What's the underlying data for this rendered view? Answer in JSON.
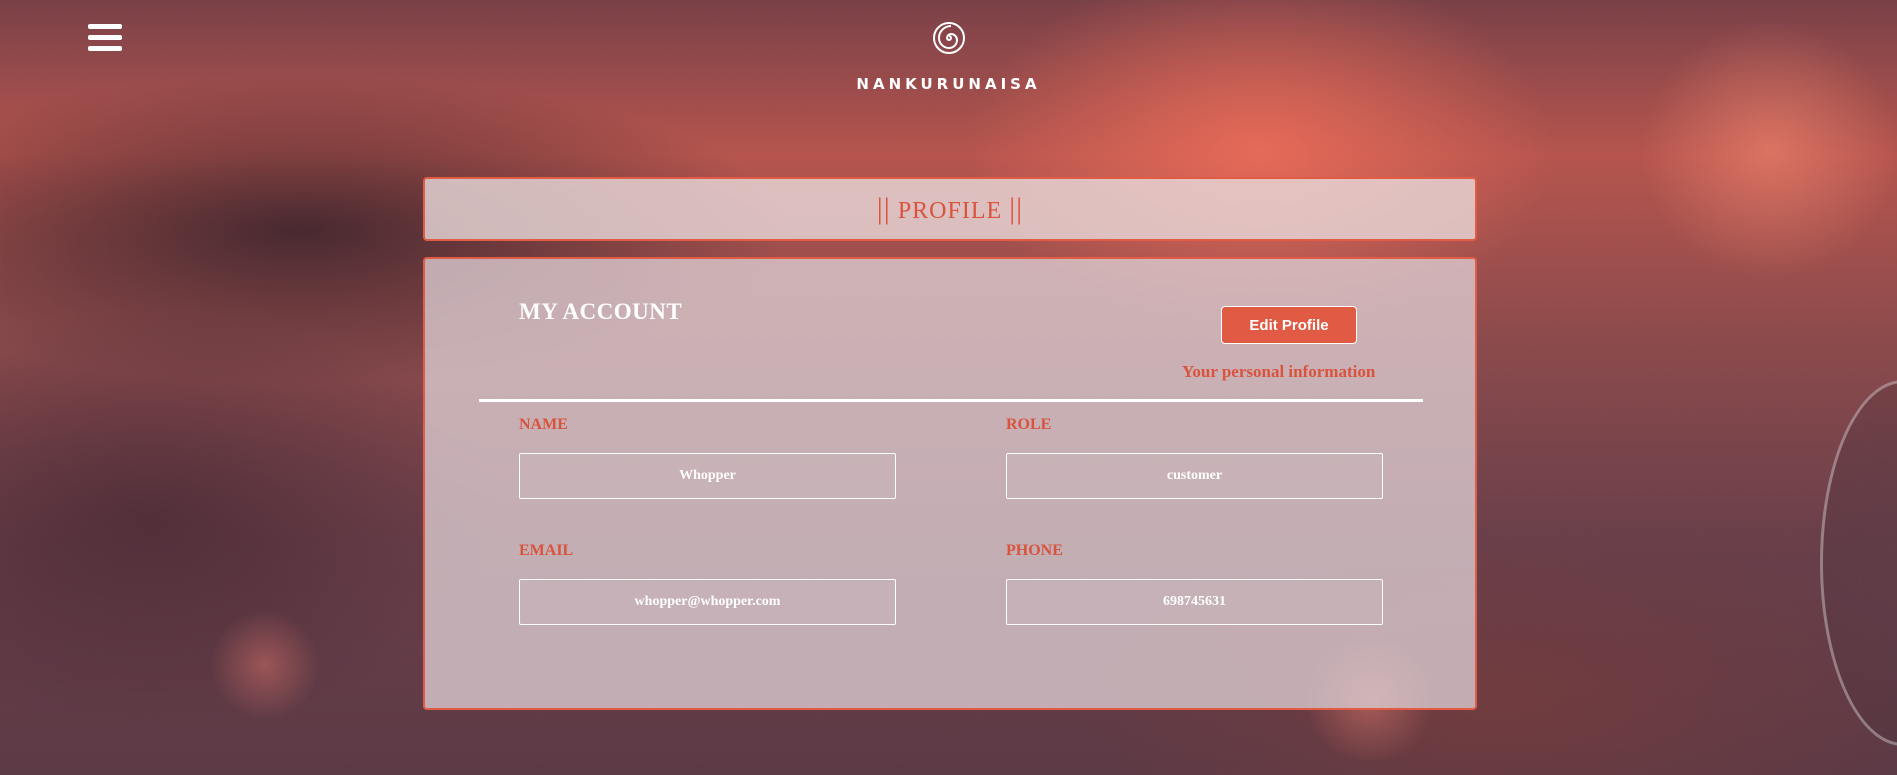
{
  "header": {
    "brand": "NANKURUNAISA",
    "logo_icon": "spiral-icon",
    "menu_icon": "hamburger-icon"
  },
  "title_bar": {
    "left_bars": "||",
    "title": "PROFILE",
    "right_bars": "||"
  },
  "account": {
    "heading": "MY ACCOUNT",
    "edit_label": "Edit Profile",
    "subtitle": "Your personal information",
    "fields": {
      "name": {
        "label": "NAME",
        "value": "Whopper"
      },
      "role": {
        "label": "ROLE",
        "value": "customer"
      },
      "email": {
        "label": "EMAIL",
        "value": "whopper@whopper.com"
      },
      "phone": {
        "label": "PHONE",
        "value": "698745631"
      }
    }
  },
  "colors": {
    "accent": "#e05a44",
    "text_light": "#ffffff"
  }
}
